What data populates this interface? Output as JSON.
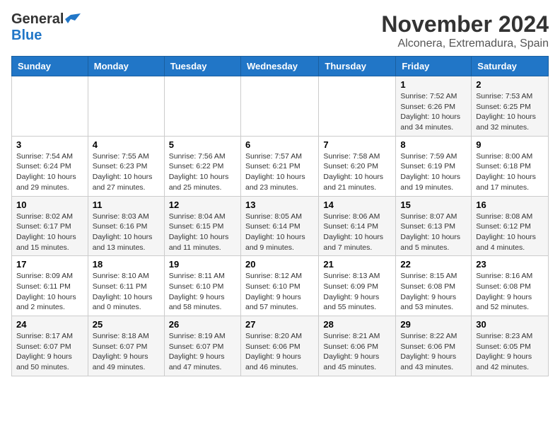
{
  "header": {
    "logo_general": "General",
    "logo_blue": "Blue",
    "month": "November 2024",
    "location": "Alconera, Extremadura, Spain"
  },
  "calendar": {
    "days_of_week": [
      "Sunday",
      "Monday",
      "Tuesday",
      "Wednesday",
      "Thursday",
      "Friday",
      "Saturday"
    ],
    "weeks": [
      [
        {
          "day": "",
          "info": ""
        },
        {
          "day": "",
          "info": ""
        },
        {
          "day": "",
          "info": ""
        },
        {
          "day": "",
          "info": ""
        },
        {
          "day": "",
          "info": ""
        },
        {
          "day": "1",
          "info": "Sunrise: 7:52 AM\nSunset: 6:26 PM\nDaylight: 10 hours and 34 minutes."
        },
        {
          "day": "2",
          "info": "Sunrise: 7:53 AM\nSunset: 6:25 PM\nDaylight: 10 hours and 32 minutes."
        }
      ],
      [
        {
          "day": "3",
          "info": "Sunrise: 7:54 AM\nSunset: 6:24 PM\nDaylight: 10 hours and 29 minutes."
        },
        {
          "day": "4",
          "info": "Sunrise: 7:55 AM\nSunset: 6:23 PM\nDaylight: 10 hours and 27 minutes."
        },
        {
          "day": "5",
          "info": "Sunrise: 7:56 AM\nSunset: 6:22 PM\nDaylight: 10 hours and 25 minutes."
        },
        {
          "day": "6",
          "info": "Sunrise: 7:57 AM\nSunset: 6:21 PM\nDaylight: 10 hours and 23 minutes."
        },
        {
          "day": "7",
          "info": "Sunrise: 7:58 AM\nSunset: 6:20 PM\nDaylight: 10 hours and 21 minutes."
        },
        {
          "day": "8",
          "info": "Sunrise: 7:59 AM\nSunset: 6:19 PM\nDaylight: 10 hours and 19 minutes."
        },
        {
          "day": "9",
          "info": "Sunrise: 8:00 AM\nSunset: 6:18 PM\nDaylight: 10 hours and 17 minutes."
        }
      ],
      [
        {
          "day": "10",
          "info": "Sunrise: 8:02 AM\nSunset: 6:17 PM\nDaylight: 10 hours and 15 minutes."
        },
        {
          "day": "11",
          "info": "Sunrise: 8:03 AM\nSunset: 6:16 PM\nDaylight: 10 hours and 13 minutes."
        },
        {
          "day": "12",
          "info": "Sunrise: 8:04 AM\nSunset: 6:15 PM\nDaylight: 10 hours and 11 minutes."
        },
        {
          "day": "13",
          "info": "Sunrise: 8:05 AM\nSunset: 6:14 PM\nDaylight: 10 hours and 9 minutes."
        },
        {
          "day": "14",
          "info": "Sunrise: 8:06 AM\nSunset: 6:14 PM\nDaylight: 10 hours and 7 minutes."
        },
        {
          "day": "15",
          "info": "Sunrise: 8:07 AM\nSunset: 6:13 PM\nDaylight: 10 hours and 5 minutes."
        },
        {
          "day": "16",
          "info": "Sunrise: 8:08 AM\nSunset: 6:12 PM\nDaylight: 10 hours and 4 minutes."
        }
      ],
      [
        {
          "day": "17",
          "info": "Sunrise: 8:09 AM\nSunset: 6:11 PM\nDaylight: 10 hours and 2 minutes."
        },
        {
          "day": "18",
          "info": "Sunrise: 8:10 AM\nSunset: 6:11 PM\nDaylight: 10 hours and 0 minutes."
        },
        {
          "day": "19",
          "info": "Sunrise: 8:11 AM\nSunset: 6:10 PM\nDaylight: 9 hours and 58 minutes."
        },
        {
          "day": "20",
          "info": "Sunrise: 8:12 AM\nSunset: 6:10 PM\nDaylight: 9 hours and 57 minutes."
        },
        {
          "day": "21",
          "info": "Sunrise: 8:13 AM\nSunset: 6:09 PM\nDaylight: 9 hours and 55 minutes."
        },
        {
          "day": "22",
          "info": "Sunrise: 8:15 AM\nSunset: 6:08 PM\nDaylight: 9 hours and 53 minutes."
        },
        {
          "day": "23",
          "info": "Sunrise: 8:16 AM\nSunset: 6:08 PM\nDaylight: 9 hours and 52 minutes."
        }
      ],
      [
        {
          "day": "24",
          "info": "Sunrise: 8:17 AM\nSunset: 6:07 PM\nDaylight: 9 hours and 50 minutes."
        },
        {
          "day": "25",
          "info": "Sunrise: 8:18 AM\nSunset: 6:07 PM\nDaylight: 9 hours and 49 minutes."
        },
        {
          "day": "26",
          "info": "Sunrise: 8:19 AM\nSunset: 6:07 PM\nDaylight: 9 hours and 47 minutes."
        },
        {
          "day": "27",
          "info": "Sunrise: 8:20 AM\nSunset: 6:06 PM\nDaylight: 9 hours and 46 minutes."
        },
        {
          "day": "28",
          "info": "Sunrise: 8:21 AM\nSunset: 6:06 PM\nDaylight: 9 hours and 45 minutes."
        },
        {
          "day": "29",
          "info": "Sunrise: 8:22 AM\nSunset: 6:06 PM\nDaylight: 9 hours and 43 minutes."
        },
        {
          "day": "30",
          "info": "Sunrise: 8:23 AM\nSunset: 6:05 PM\nDaylight: 9 hours and 42 minutes."
        }
      ]
    ]
  }
}
